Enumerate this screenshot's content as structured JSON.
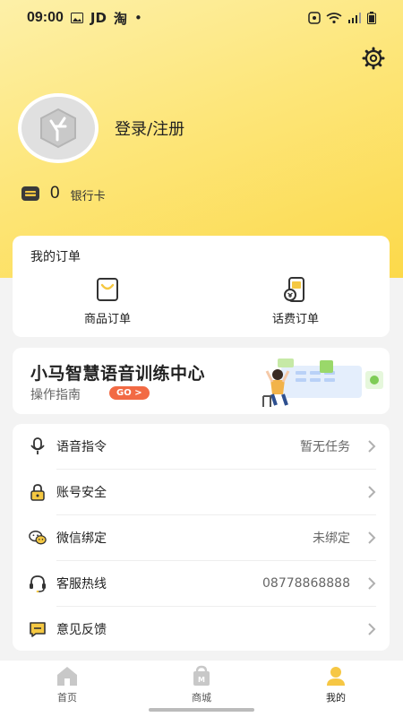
{
  "status_bar": {
    "time": "09:00",
    "jd": "JD",
    "tao": "淘",
    "dot": "•"
  },
  "profile": {
    "login_label": "登录/注册",
    "bank_count": "0",
    "bank_label": "银行卡"
  },
  "orders": {
    "title": "我的订单",
    "items": [
      {
        "label": "商品订单",
        "icon": "shopping-bag-icon"
      },
      {
        "label": "话费订单",
        "icon": "phone-bill-icon"
      }
    ]
  },
  "banner": {
    "title": "小马智慧语音训练中心",
    "subtitle": "操作指南",
    "go_label": "GO >"
  },
  "menu": [
    {
      "label": "语音指令",
      "value": "暂无任务",
      "icon": "microphone-icon"
    },
    {
      "label": "账号安全",
      "value": "",
      "icon": "lock-icon"
    },
    {
      "label": "微信绑定",
      "value": "未绑定",
      "icon": "wechat-icon"
    },
    {
      "label": "客服热线",
      "value": "08778868888",
      "icon": "headset-icon"
    },
    {
      "label": "意见反馈",
      "value": "",
      "icon": "feedback-icon"
    }
  ],
  "tabbar": [
    {
      "label": "首页",
      "icon": "home-icon",
      "active": false
    },
    {
      "label": "商城",
      "icon": "mall-icon",
      "active": false
    },
    {
      "label": "我的",
      "icon": "profile-icon",
      "active": true
    }
  ],
  "colors": {
    "accent": "#fcd94a",
    "go_button": "#f26a44",
    "active_tab": "#f6c744"
  }
}
